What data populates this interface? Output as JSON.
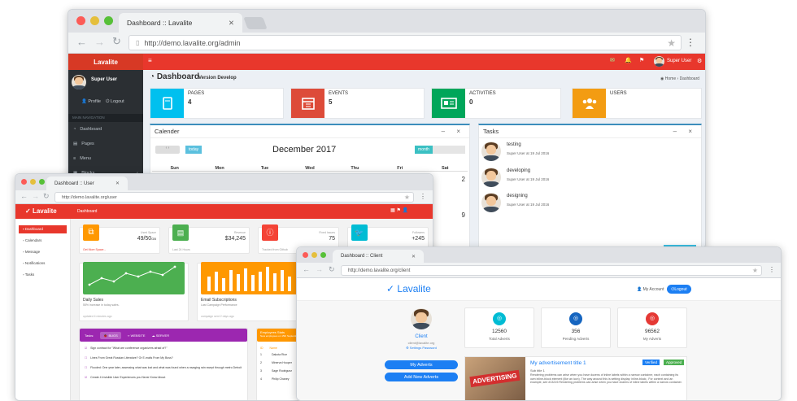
{
  "admin_window": {
    "tab_title": "Dashboard :: Lavalite",
    "url": "http://demo.lavalite.org/admin",
    "brand": "Lavalite",
    "user_name": "Super User",
    "profile": "Profile",
    "logout": "Logout",
    "nav_header": "MAIN NAVIGATION",
    "nav": [
      "Dashboard",
      "Pages",
      "Menu",
      "Blocks"
    ],
    "page_title": "Dashboard",
    "page_subtitle": "Version Develop",
    "breadcrumb_home": "Home",
    "breadcrumb_current": "Dashboard",
    "infoboxes": [
      {
        "label": "PAGES",
        "value": "4",
        "color": "#00c0ef",
        "icon": "book-icon"
      },
      {
        "label": "EVENTS",
        "value": "5",
        "color": "#dd4b39",
        "icon": "calendar-icon"
      },
      {
        "label": "ACTIVITIES",
        "value": "0",
        "color": "#00a65a",
        "icon": "newspaper-icon"
      },
      {
        "label": "USERS",
        "value": "",
        "color": "#f39c12",
        "icon": "users-icon"
      }
    ],
    "calendar": {
      "title": "Calender",
      "today": "today",
      "month_label": "December 2017",
      "view": "month",
      "days": [
        "Sun",
        "Mon",
        "Tue",
        "Wed",
        "Thu",
        "Fri",
        "Sat"
      ],
      "dates": [
        "2",
        "9"
      ]
    },
    "tasks": {
      "title": "Tasks",
      "items": [
        {
          "name": "testing",
          "meta": "Super User at 19 Jul 2016"
        },
        {
          "name": "developing",
          "meta": "Super User at 19 Jul 2016"
        },
        {
          "name": "designing",
          "meta": "Super User at 19 Jul 2016"
        }
      ]
    }
  },
  "user_window": {
    "tab_title": "Dashboard :: User",
    "url": "http://demo.lavalite.org/user",
    "brand": "Lavalite",
    "header_link": "Dashboard",
    "nav": [
      "Dashboard",
      "Calendars",
      "Message",
      "Notifications",
      "Tasks"
    ],
    "stats": [
      {
        "label": "Used Space",
        "value": "49/50",
        "unit": "GB",
        "foot": "Get More Space...",
        "color": "#ff9800"
      },
      {
        "label": "Revenue",
        "value": "$34,245",
        "unit": "",
        "foot": "Last 24 Hours",
        "color": "#4caf50"
      },
      {
        "label": "Fixed Issues",
        "value": "75",
        "unit": "",
        "foot": "Tracked from Github",
        "color": "#f44336"
      },
      {
        "label": "Followers",
        "value": "+245",
        "unit": "",
        "foot": "Just Updated",
        "color": "#00bcd4"
      }
    ],
    "charts": [
      {
        "title": "Daily Sales",
        "sub": "55% increase in today sales.",
        "foot": "updated 4 minutes ago",
        "color": "#4caf50"
      },
      {
        "title": "Email Subscriptions",
        "sub": "Last Campaign Performance",
        "foot": "campaign sent 2 days ago",
        "color": "#ff9800"
      }
    ],
    "tasks_card": {
      "label": "Tasks:",
      "tabs": [
        "BUGS",
        "WEBSITE",
        "SERVER"
      ],
      "items": [
        "Sign contract for \"What are conference organizers afraid of?\"",
        "Lines From Great Russian Literature? Or E-mails From My Boss?",
        "Flooded: One year later, assessing what was lost and what was found when a ravaging rain swept through metro Detroit",
        "Create 4 Invisible User Experiences you Never Knew About"
      ]
    },
    "employees": {
      "title": "Employees Stats",
      "sub": "New employees on 15th September, 2016",
      "columns": [
        "ID",
        "Name"
      ],
      "rows": [
        [
          "1",
          "Dakota Rice"
        ],
        [
          "2",
          "Minerva Hooper"
        ],
        [
          "3",
          "Sage Rodriguez"
        ],
        [
          "4",
          "Philip Chaney"
        ]
      ]
    }
  },
  "client_window": {
    "tab_title": "Dashboard :: Client",
    "url": "http://demo.lavalite.org/client",
    "brand": "Lavalite",
    "my_account": "My Account",
    "logout": "Logout",
    "profile_name": "Client",
    "profile_email": "client@lavalite.org",
    "profile_links": "Settings  Password",
    "btn_my_adverts": "My Adverts",
    "btn_add_new": "Add New Adverts",
    "stats": [
      {
        "value": "12560",
        "label": "Total Adverts",
        "color": "#00bcd4"
      },
      {
        "value": "356",
        "label": "Pending Adverts",
        "color": "#1565c0"
      },
      {
        "value": "96562",
        "label": "My Adverts",
        "color": "#e53935"
      }
    ],
    "advert": {
      "title": "My advertisement title 1",
      "badge_verified": "Verified",
      "badge_approved": "Approved",
      "subtitle": "Sub title 1",
      "text": "Rendering problems can arise when you have dozens of inline labels within a narrow container, each containing its own inline-block element (like an icon). The way around this is setting display: inline-block;. For context and an example, see #13219.Rendering problems can arise when you have dozens of inline labels within a narrow container.",
      "image_text": "ADVERTISING"
    }
  }
}
